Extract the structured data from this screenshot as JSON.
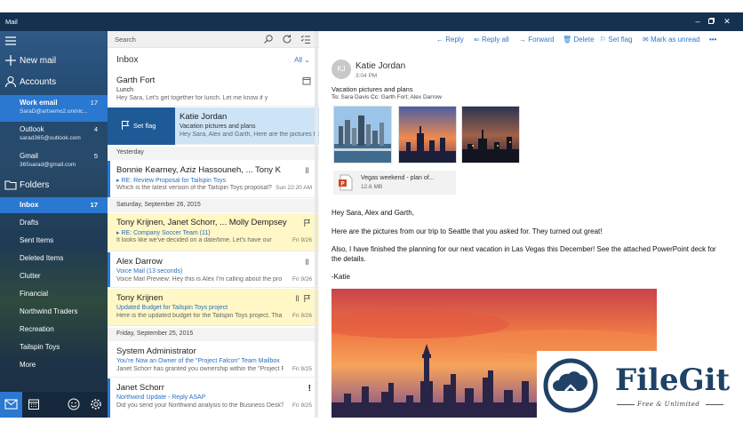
{
  "window": {
    "title": "Mail",
    "controls": [
      "minimize-icon",
      "restore-icon",
      "close-icon"
    ]
  },
  "nav": {
    "menu_icon": "hamburger-menu-icon",
    "new_mail": "New mail",
    "accounts_label": "Accounts",
    "accounts": [
      {
        "name": "Work email",
        "email": "SaraD@artsemo2.onmic...",
        "count": "17",
        "active": true
      },
      {
        "name": "Outlook",
        "email": "sarad365@outlook.com",
        "count": "4",
        "active": false
      },
      {
        "name": "Gmail",
        "email": "365sarad@gmail.com",
        "count": "5",
        "active": false
      }
    ],
    "folders_label": "Folders",
    "folders": [
      {
        "name": "Inbox",
        "count": "17",
        "active": true
      },
      {
        "name": "Drafts",
        "count": ""
      },
      {
        "name": "Sent Items",
        "count": ""
      },
      {
        "name": "Deleted Items",
        "count": ""
      },
      {
        "name": "Clutter",
        "count": ""
      },
      {
        "name": "Financial",
        "count": ""
      },
      {
        "name": "Northwind Traders",
        "count": ""
      },
      {
        "name": "Recreation",
        "count": ""
      },
      {
        "name": "Tailspin Toys",
        "count": ""
      },
      {
        "name": "More",
        "count": ""
      }
    ],
    "footer_icons": [
      "mail-icon",
      "calendar-icon",
      "smiley-feedback-icon",
      "settings-gear-icon"
    ]
  },
  "list": {
    "search_placeholder": "Search",
    "folder_title": "Inbox",
    "filter": "All",
    "messages": [
      {
        "from": "Garth Fort",
        "subject": "Lunch",
        "preview": "Hey Sara, Let's get together for lunch. Let me know if y",
        "date": "",
        "style": "plain"
      },
      {
        "from": "Katie Jordan",
        "subject": "Vacation pictures and plans",
        "preview": "Hey Sara, Alex and Garth, Here are the pictures fro",
        "date": "",
        "style": "selected",
        "swipe_action": "Set flag"
      },
      {
        "from": "Bonnie Kearney, Aziz Hassouneh, ... Tony K",
        "subject": "▸ RE: Review Proposal for Tailspin Toys",
        "preview": "Which is the latest version of the Tailspin Toys proposal?",
        "date": "Sun 22:20 AM",
        "style": "plain"
      },
      {
        "from": "Tony Krijnen, Janet Schorr, ... Molly Dempsey",
        "subject": "▸ RE: Company Soccer Team (11)",
        "preview": "It looks like we've decided on a date/time. Let's have our",
        "date": "Fri 9/26",
        "style": "yellow"
      },
      {
        "from": "Alex Darrow",
        "subject": "Voice Mail (13 seconds)",
        "preview": "Voice Mail Preview: Hey this is Alex I'm calling about the pro",
        "date": "Fri 9/26",
        "style": "accent"
      },
      {
        "from": "Tony Krijnen",
        "subject": "Updated Budget for Tailspin Toys project",
        "preview": "Here is the updated budget for the Tailspin Toys project. Tha",
        "date": "Fri 9/26",
        "style": "yellow"
      },
      {
        "from": "System Administrator",
        "subject": "You're Now an Owner of the \"Project Falcon\" Team Mailbox",
        "preview": "Janet Schorr has granted you ownership within the \"Project F",
        "date": "Fri 9/25",
        "style": "plain"
      },
      {
        "from": "Janet Schorr",
        "subject": "Northwind Update - Reply ASAP",
        "preview": "Did you send your Northwind analysis to the Business Desk?",
        "date": "Fri 9/25",
        "style": "accent"
      }
    ],
    "days": [
      "Yesterday",
      "Saturday, September 26, 2015",
      "Friday, September 25, 2015"
    ]
  },
  "reading": {
    "toolbar": [
      "Reply",
      "Reply all",
      "Forward",
      "Delete",
      "Set flag",
      "Mark as unread",
      "•••"
    ],
    "avatar_initials": "KJ",
    "sender": "Katie Jordan",
    "time": "3:04 PM",
    "subject": "Vacation pictures and plans",
    "to_label": "To:",
    "to": "Sara Davis",
    "cc_label": "Cc:",
    "cc": "Garth Fort; Alex Darrow",
    "attachment": {
      "name": "Vegas weekend - plan of...",
      "size": "12.6 MB",
      "icon": "powerpoint-file-icon"
    },
    "body": [
      "Hey Sara, Alex and Garth,",
      "Here are the pictures from our trip to Seattle that you asked for. They turned out great!",
      "Also, I have finished the planning for our next vacation in Las Vegas this December! See the attached PowerPoint deck for the details.",
      "-Katie"
    ]
  },
  "watermark": {
    "brand": "FileGit",
    "tagline": "Free & Unlimited"
  }
}
